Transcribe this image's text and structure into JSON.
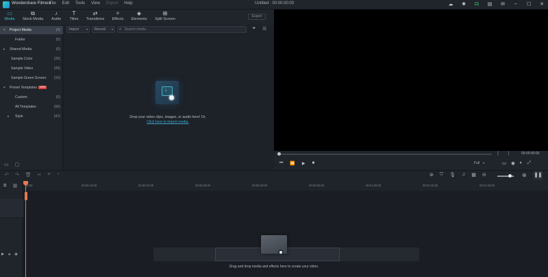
{
  "titlebar": {
    "app_name": "Wondershare Filmora",
    "menu": [
      "File",
      "Edit",
      "Tools",
      "View",
      "Export",
      "Help"
    ],
    "document": "Untitled : 00:00:00:00",
    "icons": [
      "cloud-icon",
      "bulb-icon",
      "headset-icon",
      "save-icon",
      "notification-icon",
      "minimize-icon",
      "maximize-icon",
      "close-icon"
    ]
  },
  "tabs": [
    {
      "label": "Media",
      "icon": "folder-icon",
      "active": true
    },
    {
      "label": "Stock Media",
      "icon": "stock-media-icon"
    },
    {
      "label": "Audio",
      "icon": "music-note-icon"
    },
    {
      "label": "Titles",
      "icon": "text-t-icon"
    },
    {
      "label": "Transitions",
      "icon": "transition-icon"
    },
    {
      "label": "Effects",
      "icon": "effects-icon"
    },
    {
      "label": "Elements",
      "icon": "elements-icon"
    },
    {
      "label": "Split Screen",
      "icon": "split-screen-icon"
    }
  ],
  "export_label": "Export",
  "left_panel": {
    "items": [
      {
        "label": "Project Media",
        "count": "(0)",
        "selected": true,
        "arrow": "▾"
      },
      {
        "label": "Folder",
        "count": "(0)"
      },
      {
        "label": "Shared Media",
        "count": "(0)",
        "arrow": "▸"
      },
      {
        "label": "Sample Color",
        "count": "(25)"
      },
      {
        "label": "Sample Video",
        "count": "(20)"
      },
      {
        "label": "Sample Green Screen",
        "count": "(10)"
      },
      {
        "label": "Preset Templates",
        "badge": "NEW",
        "arrow": "▾"
      },
      {
        "label": "Custom",
        "count": "(0)"
      },
      {
        "label": "All Templates",
        "count": "(50)"
      },
      {
        "label": "Style",
        "count": "(47)",
        "arrow": "▸"
      }
    ]
  },
  "media_bar": {
    "import_label": "Import",
    "record_label": "Record",
    "search_placeholder": "Search media"
  },
  "drop": {
    "text": "Drop your video clips, images, or audio here! Or,",
    "link": "Click here to import media."
  },
  "player": {
    "timecode": "00:00:00:00",
    "quality": "Full",
    "marks": "{ }"
  },
  "timeline": {
    "ticks": [
      "00:00",
      "00:00:10:00",
      "00:00:20:00",
      "00:00:30:00",
      "00:00:40:00",
      "00:00:50:00",
      "00:01:00:00",
      "00:01:10:00",
      "00:01:20:00"
    ],
    "drag_text": "Drag and drop media and effects here to create your video."
  },
  "colors": {
    "accent": "#33c4c6",
    "playhead": "#e8794d",
    "badge": "#d8443f"
  }
}
